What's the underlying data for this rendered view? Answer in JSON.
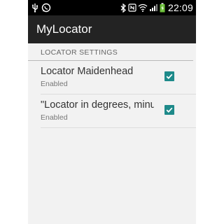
{
  "status_bar": {
    "time": "22:09",
    "left_icons": [
      "usb-icon",
      "whatsapp-icon"
    ],
    "right_icons": [
      "bluetooth-icon",
      "nfc-icon",
      "wifi-icon",
      "signal-icon",
      "battery-charging-icon"
    ]
  },
  "app": {
    "title": "MyLocator"
  },
  "settings": {
    "section_header": "LOCATOR SETTINGS",
    "items": [
      {
        "title": "Locator Maidenhead",
        "summary": "Enabled",
        "checked": true
      },
      {
        "title": "\"Locator in degrees, minutes, seconds\"",
        "summary": "Enabled",
        "checked": true
      }
    ]
  },
  "colors": {
    "status_bar": "#000000",
    "action_bar": "#232323",
    "background": "#f2f2f2",
    "checkbox_accent": "#1e8a8a"
  }
}
